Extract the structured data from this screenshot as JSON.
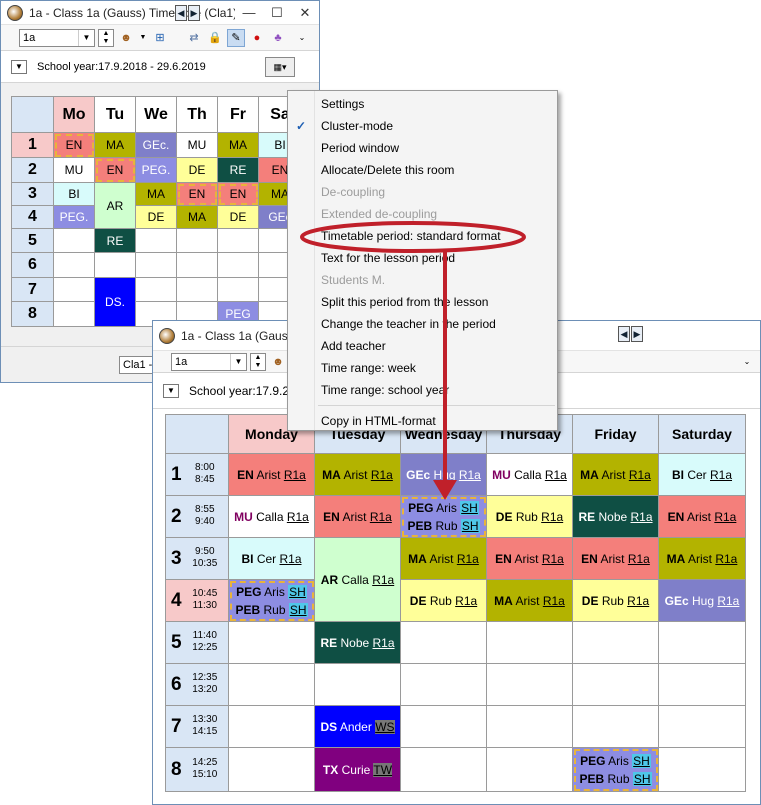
{
  "back_window": {
    "title": "1a - Class 1a (Gauss)  Timetable (Cla1)",
    "class_value": "1a",
    "school_year": "School year:17.9.2018 - 29.6.2019",
    "days": [
      "Mo",
      "Tu",
      "We",
      "Th",
      "Fr",
      "Sa"
    ],
    "periods": [
      "1",
      "2",
      "3",
      "4",
      "5",
      "6",
      "7",
      "8"
    ],
    "cells": {
      "r1": [
        "EN",
        "MA",
        "GEc.",
        "MU",
        "MA",
        "BI"
      ],
      "r2": [
        "MU",
        "EN",
        "PEG.",
        "DE",
        "RE",
        "EN"
      ],
      "r34tu": "AR",
      "r3": [
        "BI",
        "MA",
        "EN",
        "EN",
        "MA"
      ],
      "r4": [
        "PEG.",
        "DE",
        "MA",
        "DE",
        "GEc"
      ],
      "r5tu": "RE",
      "r78tu": "DS.",
      "r8fr": "PEG"
    },
    "bottom_combo": "Cla1 -"
  },
  "context_menu": {
    "items": [
      {
        "label": "Settings",
        "disabled": false,
        "checked": false
      },
      {
        "label": "Cluster-mode",
        "disabled": false,
        "checked": true
      },
      {
        "label": "Period window",
        "disabled": false,
        "checked": false
      },
      {
        "label": "Allocate/Delete this room",
        "disabled": false,
        "checked": false
      },
      {
        "label": "De-coupling",
        "disabled": true,
        "checked": false
      },
      {
        "label": "Extended de-coupling",
        "disabled": true,
        "checked": false
      },
      {
        "label": "Timetable period: standard format",
        "disabled": false,
        "checked": false
      },
      {
        "label": "Text for the lesson period",
        "disabled": false,
        "checked": false
      },
      {
        "label": "Students M.",
        "disabled": true,
        "checked": false
      },
      {
        "label": "Split this period from the lesson",
        "disabled": false,
        "checked": false
      },
      {
        "label": "Change the teacher in the period",
        "disabled": false,
        "checked": false
      },
      {
        "label": "Add teacher",
        "disabled": false,
        "checked": false
      },
      {
        "label": "Time range: week",
        "disabled": false,
        "checked": false
      },
      {
        "label": "Time range: school year",
        "disabled": false,
        "checked": false
      },
      {
        "label": "Copy in HTML-format",
        "disabled": false,
        "checked": false
      }
    ],
    "highlight_color": "#c0202a"
  },
  "front_window": {
    "title": "1a - Class 1a (Gauss)",
    "class_value": "1a",
    "school_year": "School year:17.9.20",
    "days": [
      "Monday",
      "Tuesday",
      "Wednesday",
      "Thursday",
      "Friday",
      "Saturday"
    ],
    "periods": [
      {
        "n": "1",
        "start": "8:00",
        "end": "8:45"
      },
      {
        "n": "2",
        "start": "8:55",
        "end": "9:40"
      },
      {
        "n": "3",
        "start": "9:50",
        "end": "10:35"
      },
      {
        "n": "4",
        "start": "10:45",
        "end": "11:30"
      },
      {
        "n": "5",
        "start": "11:40",
        "end": "12:25"
      },
      {
        "n": "6",
        "start": "12:35",
        "end": "13:20"
      },
      {
        "n": "7",
        "start": "13:30",
        "end": "14:15"
      },
      {
        "n": "8",
        "start": "14:25",
        "end": "15:10"
      }
    ],
    "lessons": {
      "p1": [
        {
          "s": "EN",
          "t": "Arist",
          "r": "R1a"
        },
        {
          "s": "MA",
          "t": "Arist",
          "r": "R1a"
        },
        {
          "s": "GEc",
          "t": "Hug",
          "r": "R1a"
        },
        {
          "s": "MU",
          "t": "Calla",
          "r": "R1a"
        },
        {
          "s": "MA",
          "t": "Arist",
          "r": "R1a"
        },
        {
          "s": "BI",
          "t": "Cer",
          "r": "R1a"
        }
      ],
      "p2": [
        {
          "s": "MU",
          "t": "Calla",
          "r": "R1a"
        },
        {
          "s": "EN",
          "t": "Arist",
          "r": "R1a"
        },
        {
          "s": "PEG",
          "t": "Aris",
          "r": "SH",
          "s2": "PEB",
          "t2": "Rub",
          "r2": "SH"
        },
        {
          "s": "DE",
          "t": "Rub",
          "r": "R1a"
        },
        {
          "s": "RE",
          "t": "Nobe",
          "r": "R1a"
        },
        {
          "s": "EN",
          "t": "Arist",
          "r": "R1a"
        }
      ],
      "p3": [
        {
          "s": "BI",
          "t": "Cer",
          "r": "R1a"
        },
        {
          "s": "AR",
          "t": "Calla",
          "r": "R1a"
        },
        {
          "s": "MA",
          "t": "Arist",
          "r": "R1a"
        },
        {
          "s": "EN",
          "t": "Arist",
          "r": "R1a"
        },
        {
          "s": "EN",
          "t": "Arist",
          "r": "R1a"
        },
        {
          "s": "MA",
          "t": "Arist",
          "r": "R1a"
        }
      ],
      "p4": [
        {
          "s": "PEG",
          "t": "Aris",
          "r": "SH",
          "s2": "PEB",
          "t2": "Rub",
          "r2": "SH"
        },
        {
          "s": "DE",
          "t": "Rub",
          "r": "R1a"
        },
        {
          "s": "MA",
          "t": "Arist",
          "r": "R1a"
        },
        {
          "s": "DE",
          "t": "Rub",
          "r": "R1a"
        },
        {
          "s": "GEc",
          "t": "Hug",
          "r": "R1a"
        }
      ],
      "p5tu": {
        "s": "RE",
        "t": "Nobe",
        "r": "R1a"
      },
      "p7tu": {
        "s": "DS",
        "t": "Ander",
        "r": "WS"
      },
      "p8tu": {
        "s": "TX",
        "t": "Curie",
        "r": "TW"
      },
      "p8fr": {
        "s": "PEG",
        "t": "Aris",
        "r": "SH",
        "s2": "PEB",
        "t2": "Rub",
        "r2": "SH"
      }
    }
  },
  "colors": {
    "EN": "#f47f7b",
    "MA": "#b3b300",
    "GEc": "#7f7fc9",
    "MU": "#ffffff",
    "BI": "#d8fbfb",
    "DE": "#ffff99",
    "RE": "#0f4f44",
    "PEG": "#8d8de2",
    "AR": "#cfffcf",
    "DS": "#0000ff",
    "TX": "#80007f"
  }
}
